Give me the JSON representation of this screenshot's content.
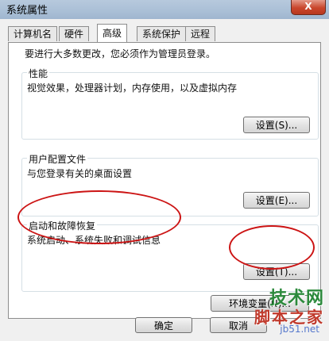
{
  "window": {
    "title": "系统属性",
    "close_label": "X"
  },
  "tabs": [
    {
      "label": "计算机名"
    },
    {
      "label": "硬件"
    },
    {
      "label": "高级"
    },
    {
      "label": "系统保护"
    },
    {
      "label": "远程"
    }
  ],
  "active_tab": "高级",
  "notice": "要进行大多数更改，您必须作为管理员登录。",
  "performance": {
    "title": "性能",
    "desc": "视觉效果，处理器计划，内存使用，以及虚拟内存",
    "button": "设置(S)..."
  },
  "user_profiles": {
    "title": "用户配置文件",
    "desc": "与您登录有关的桌面设置",
    "button": "设置(E)..."
  },
  "startup_recovery": {
    "title": "启动和故障恢复",
    "desc": "系统启动、系统失败和调试信息",
    "button": "设置(T)..."
  },
  "env_button": "环境变量(N)...",
  "footer": {
    "ok": "确定",
    "cancel": "取消"
  },
  "annotation_color": "#cc1414",
  "watermark": {
    "site": "技术网",
    "tagline": "脚本之家",
    "url": "jb51.net"
  }
}
